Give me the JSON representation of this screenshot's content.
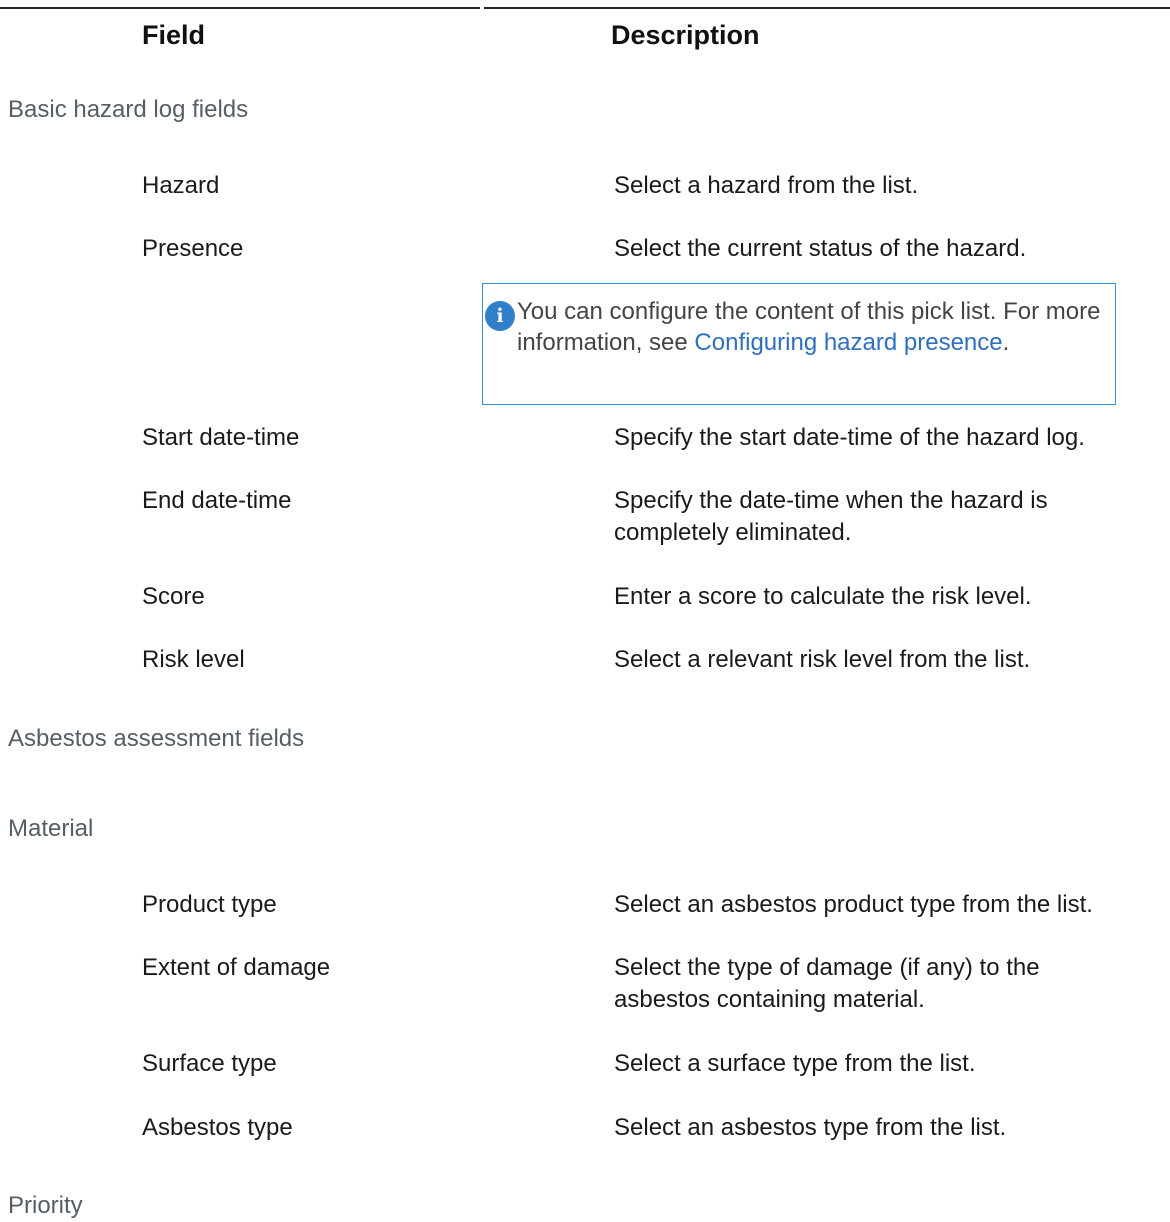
{
  "table": {
    "headers": {
      "field": "Field",
      "description": "Description"
    }
  },
  "sections": {
    "basic": "Basic hazard log fields",
    "asbestos": "Asbestos assessment fields",
    "material": "Material",
    "priority": "Priority"
  },
  "rows": [
    {
      "field": "Hazard",
      "description": "Select a hazard from the list."
    },
    {
      "field": "Presence",
      "description": "Select the current status of the hazard."
    },
    {
      "field": "Start date-time",
      "description": "Specify the start date-time of the hazard log."
    },
    {
      "field": "End date-time",
      "description": "Specify the date-time when the hazard is completely eliminated."
    },
    {
      "field": "Score",
      "description": "Enter a score to calculate the risk level."
    },
    {
      "field": "Risk level",
      "description": "Select a relevant risk level from the list."
    },
    {
      "field": "Product type",
      "description": "Select an asbestos product type from the list."
    },
    {
      "field": "Extent of damage",
      "description": "Select the type of damage (if any) to the asbestos containing material."
    },
    {
      "field": "Surface type",
      "description": "Select a surface type from the list."
    },
    {
      "field": "Asbestos type",
      "description": "Select an asbestos type from the list."
    }
  ],
  "note": {
    "icon": "info-icon",
    "icon_glyph": "i",
    "text_before": "You can configure the content of this pick list. For more information, see ",
    "link_text": "Configuring hazard presence",
    "text_after": "."
  },
  "colors": {
    "link": "#2f6fc0",
    "note_border": "#3a8fd6",
    "section_text": "#555e66"
  }
}
